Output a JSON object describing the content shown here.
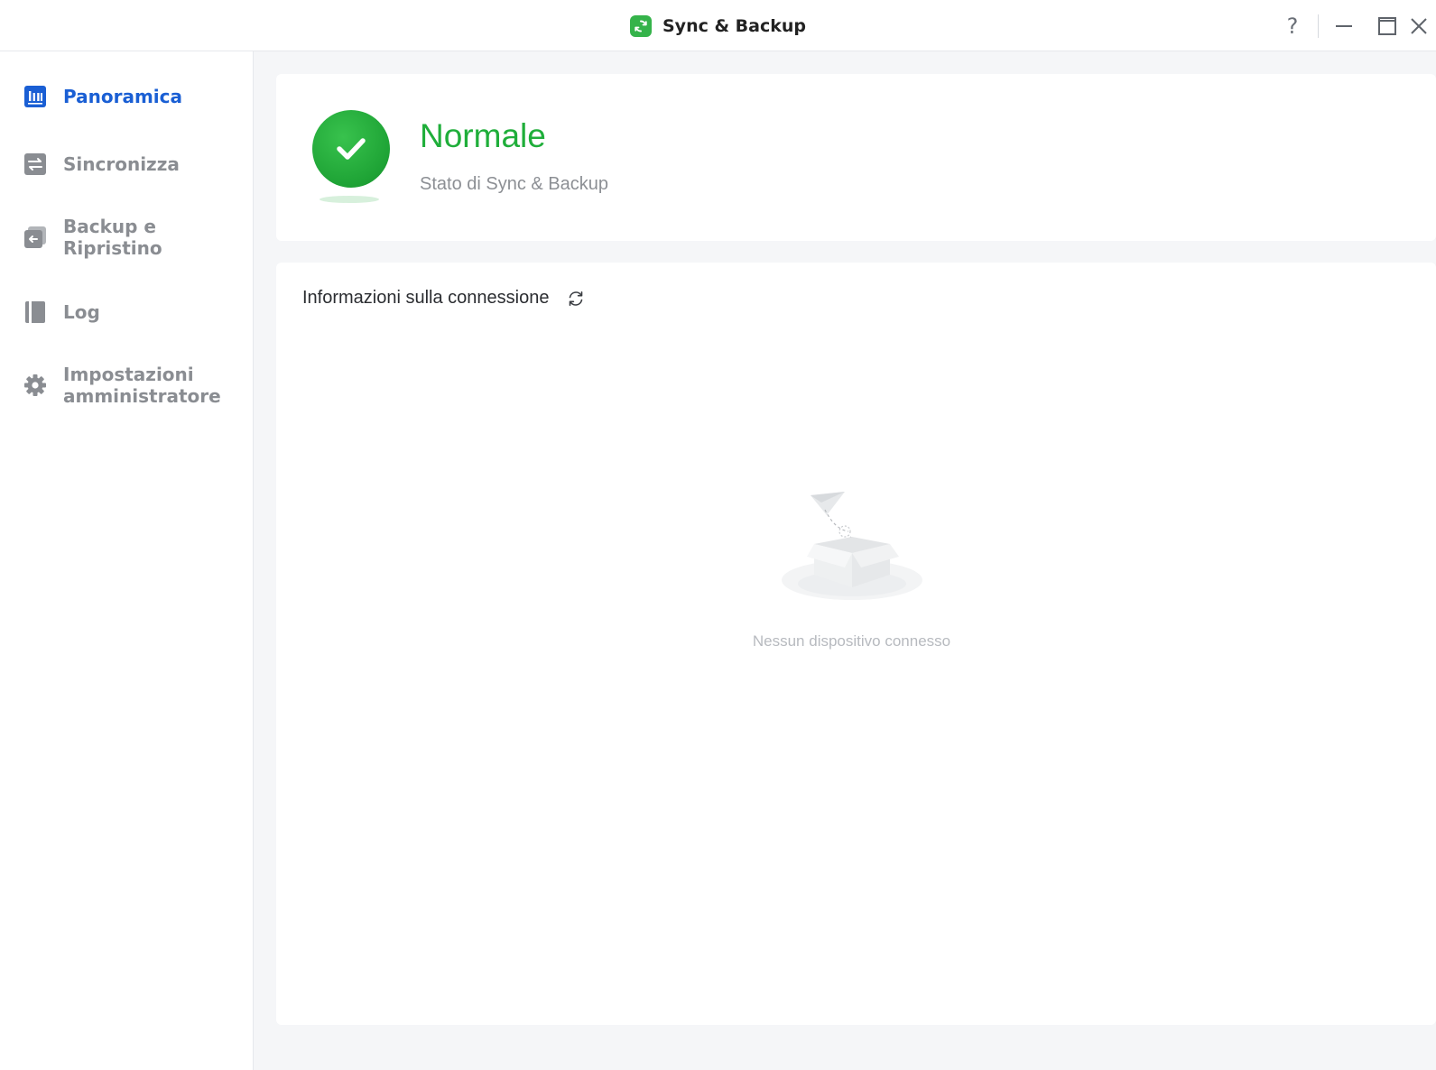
{
  "window": {
    "title": "Sync & Backup",
    "controls": {
      "help_symbol": "?"
    }
  },
  "colors": {
    "accent": "#1a5fd4",
    "success": "#1fae3a",
    "nav_inactive": "#8a8d92"
  },
  "sidebar": {
    "items": [
      {
        "label": "Panoramica",
        "icon": "dashboard-icon",
        "active": true
      },
      {
        "label": "Sincronizza",
        "icon": "sync-arrows-icon",
        "active": false
      },
      {
        "label_line1": "Backup e",
        "label_line2": "Ripristino",
        "icon": "backup-restore-icon",
        "active": false
      },
      {
        "label": "Log",
        "icon": "log-book-icon",
        "active": false
      },
      {
        "label_line1": "Impostazioni",
        "label_line2": "amministratore",
        "icon": "gear-icon",
        "active": false
      }
    ]
  },
  "status": {
    "title": "Normale",
    "subtitle": "Stato di Sync & Backup",
    "icon": "check-circle-icon"
  },
  "connection": {
    "title": "Informazioni sulla connessione",
    "refresh_icon": "refresh-icon",
    "empty_text": "Nessun dispositivo connesso",
    "empty_icon": "empty-box-icon"
  }
}
